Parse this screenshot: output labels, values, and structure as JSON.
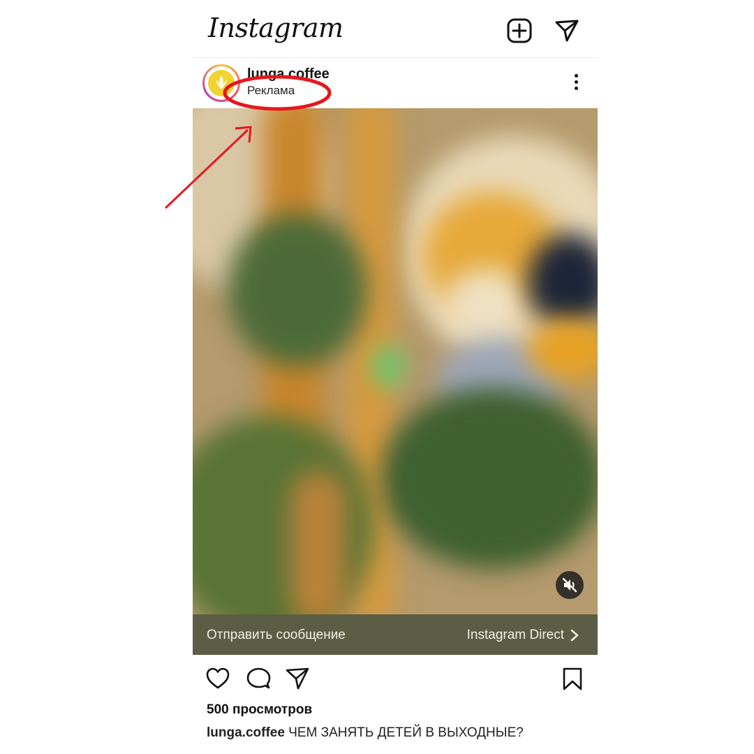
{
  "app": {
    "logo_text": "Instagram"
  },
  "topbar": {
    "icons": [
      "new-post-plus-icon",
      "direct-send-icon"
    ]
  },
  "post": {
    "username": "lunga.coffee",
    "sponsored_label": "Реклама",
    "avatar_color": "#f2d330",
    "menu_icon": "more-vertical-icon",
    "media": {
      "mute_icon": "speaker-muted-icon"
    },
    "cta": {
      "left_label": "Отправить сообщение",
      "right_label": "Instagram Direct",
      "background": "#5b5d45"
    },
    "actions": {
      "icons": [
        "heart-icon",
        "comment-icon",
        "share-icon",
        "bookmark-icon"
      ]
    },
    "views": "500 просмотров",
    "caption": {
      "user": "lunga.coffee",
      "text": "ЧЕМ ЗАНЯТЬ ДЕТЕЙ В ВЫХОДНЫЕ?"
    }
  },
  "annotation": {
    "color": "#e5171f"
  }
}
